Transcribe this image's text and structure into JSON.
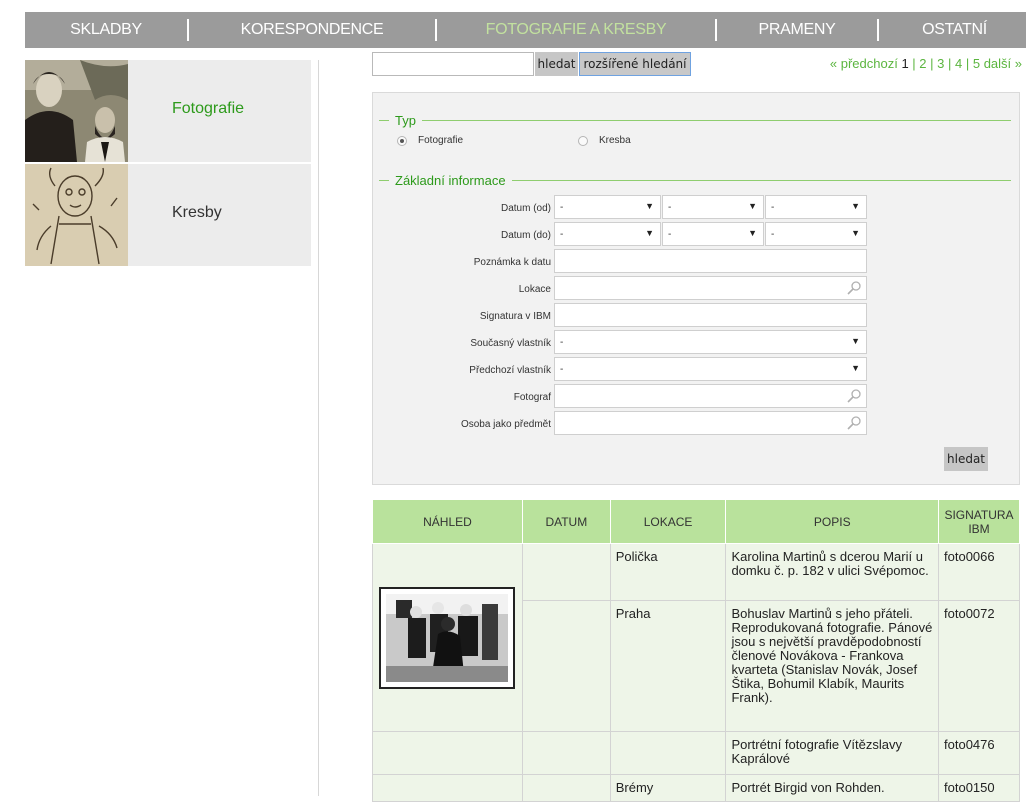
{
  "nav": {
    "items": [
      {
        "label": "SKLADBY"
      },
      {
        "label": "KORESPONDENCE"
      },
      {
        "label": "FOTOGRAFIE A KRESBY"
      },
      {
        "label": "PRAMENY"
      },
      {
        "label": "OSTATNÍ"
      }
    ],
    "active_index": 2
  },
  "sidebar": {
    "items": [
      {
        "label": "Fotografie",
        "active": true
      },
      {
        "label": "Kresby",
        "active": false
      }
    ]
  },
  "search": {
    "value": "",
    "search_button": "hledat",
    "advanced_button": "rozšířené hledání"
  },
  "pager": {
    "prev": "« předchozí",
    "current": "1",
    "pages": [
      "2",
      "3",
      "4",
      "5"
    ],
    "next": "další »"
  },
  "filter": {
    "type_legend": "Typ",
    "type_options": [
      {
        "label": "Fotografie",
        "checked": true
      },
      {
        "label": "Kresba",
        "checked": false
      }
    ],
    "basic_legend": "Základní informace",
    "fields": {
      "date_from": {
        "label": "Datum (od)",
        "values": [
          "-",
          "-",
          "-"
        ]
      },
      "date_to": {
        "label": "Datum (do)",
        "values": [
          "-",
          "-",
          "-"
        ]
      },
      "date_note": {
        "label": "Poznámka k datu",
        "value": ""
      },
      "location": {
        "label": "Lokace",
        "value": ""
      },
      "signature": {
        "label": "Signatura v IBM",
        "value": ""
      },
      "current_owner": {
        "label": "Současný vlastník",
        "value": "-"
      },
      "previous_owner": {
        "label": "Předchozí vlastník",
        "value": "-"
      },
      "photographer": {
        "label": "Fotograf",
        "value": ""
      },
      "person_subject": {
        "label": "Osoba jako předmět",
        "value": ""
      }
    },
    "submit": "hledat"
  },
  "table": {
    "headers": [
      "NÁHLED",
      "DATUM",
      "LOKACE",
      "POPIS",
      "SIGNATURA IBM"
    ],
    "rows": [
      {
        "date": "",
        "location": "Polička",
        "description": "Karolina Martinů s dcerou Marií u domku č. p. 182 v ulici Svépomoc.",
        "signature": "foto0066"
      },
      {
        "date": "",
        "location": "Praha",
        "description": "Bohuslav Martinů s jeho přáteli. Reprodukovaná fotografie. Pánové jsou s největší pravděpodobností členové Novákova - Frankova kvarteta (Stanislav Novák, Josef Štika, Bohumil Klabík, Maurits Frank).",
        "signature": "foto0072"
      },
      {
        "date": "",
        "location": "",
        "description": "Portrétní fotografie Vítězslavy Kaprálové",
        "signature": "foto0476"
      },
      {
        "date": "",
        "location": "Brémy",
        "description": "Portrét Birgid von Rohden.",
        "signature": "foto0150"
      }
    ]
  },
  "colors": {
    "nav_bg": "#9b9b9b",
    "accent_green": "#2d9a1b",
    "table_header": "#b9e29c",
    "table_cell": "#eef5e8"
  }
}
